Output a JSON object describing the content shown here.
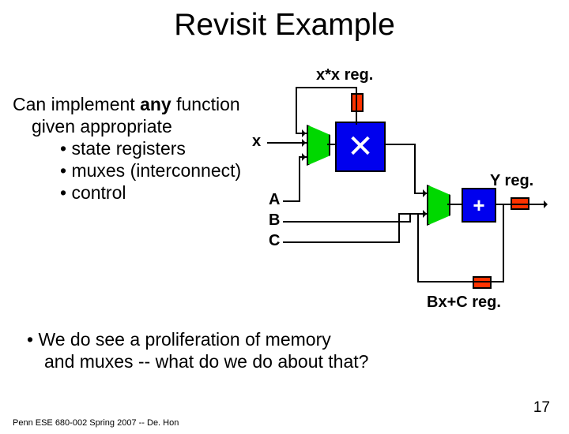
{
  "title": "Revisit Example",
  "body": {
    "line1a": "Can implement ",
    "line1_bold": "any",
    "line1b": " function",
    "line2": "given appropriate",
    "bullet1": "• state registers",
    "bullet2": "• muxes (interconnect)",
    "bullet3": "• control"
  },
  "diagram": {
    "xx_reg": "x*x reg.",
    "x": "x",
    "A": "A",
    "B": "B",
    "C": "C",
    "Y_reg": "Y reg.",
    "BxC_reg": "Bx+C reg.",
    "mult": "✕",
    "plus": "+"
  },
  "proliferation": {
    "l1": "• We do see a proliferation of memory",
    "l2": "and muxes -- what do we do about that?"
  },
  "footer": "Penn ESE 680-002 Spring 2007 -- De. Hon",
  "slidenum": "17"
}
